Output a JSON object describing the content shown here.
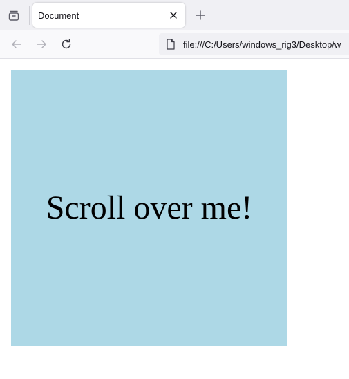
{
  "browser": {
    "tab": {
      "title": "Document"
    },
    "address_bar": {
      "url": "file:///C:/Users/windows_rig3/Desktop/w"
    },
    "icons": {
      "tab_overview": "tab-overview-icon",
      "tab_close": "close-icon",
      "new_tab": "plus-icon",
      "back": "back-arrow-icon",
      "forward": "forward-arrow-icon",
      "reload": "reload-icon",
      "page": "page-icon"
    }
  },
  "page": {
    "box": {
      "text": "Scroll over me!",
      "background": "#add8e6"
    }
  }
}
